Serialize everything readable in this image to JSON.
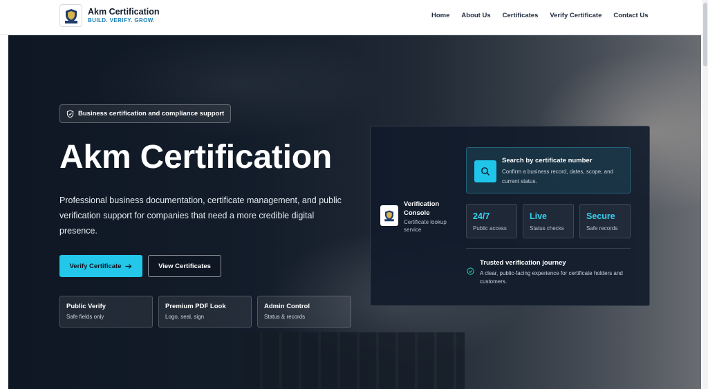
{
  "header": {
    "brand_name": "Akm Certification",
    "brand_tagline": "BUILD. VERIFY. GROW.",
    "logo_text": "AKM",
    "nav": [
      "Home",
      "About Us",
      "Certificates",
      "Verify Certificate",
      "Contact Us"
    ]
  },
  "hero": {
    "badge": "Business certification and compliance support",
    "title": "Akm Certification",
    "description": "Professional business documentation, certificate management, and public verification support for companies that need a more credible digital presence.",
    "primary_button": "Verify Certificate",
    "secondary_button": "View Certificates",
    "features": [
      {
        "title": "Public Verify",
        "subtitle": "Safe fields only"
      },
      {
        "title": "Premium PDF Look",
        "subtitle": "Logo, seal, sign"
      },
      {
        "title": "Admin Control",
        "subtitle": "Status & records"
      }
    ]
  },
  "console": {
    "title": "Verification Console",
    "subtitle": "Certificate lookup service",
    "search_title": "Search by certificate number",
    "search_desc": "Confirm a business record, dates, scope, and current status.",
    "stats": [
      {
        "value": "24/7",
        "label": "Public access"
      },
      {
        "value": "Live",
        "label": "Status checks"
      },
      {
        "value": "Secure",
        "label": "Safe records"
      }
    ],
    "journey_title": "Trusted verification journey",
    "journey_desc": "A clear, public-facing experience for certificate holders and customers."
  },
  "colors": {
    "accent": "#22c7ea",
    "brand_tagline": "#1a7fb8",
    "stat_value": "#35d0f0"
  }
}
